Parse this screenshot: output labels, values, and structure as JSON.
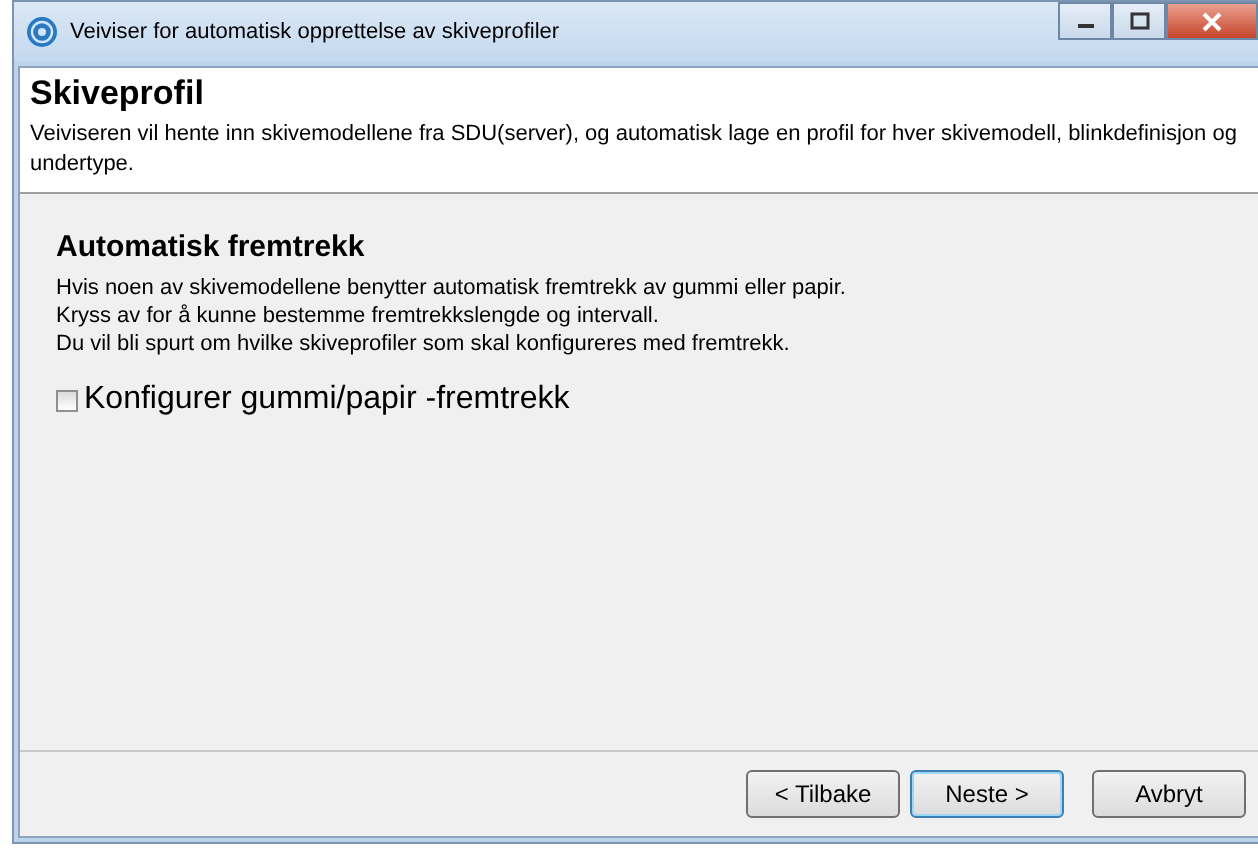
{
  "window": {
    "title": "Veiviser for automatisk opprettelse av skiveprofiler"
  },
  "header": {
    "title": "Skiveprofil",
    "description": "Veiviseren vil hente inn skivemodellene fra SDU(server), og automatisk lage en profil for hver skivemodell, blinkdefinisjon og undertype."
  },
  "section": {
    "title": "Automatisk fremtrekk",
    "lines": [
      "Hvis noen av skivemodellene benytter automatisk fremtrekk av gummi eller papir.",
      "Kryss av for å kunne bestemme fremtrekkslengde og intervall.",
      "Du vil bli spurt om hvilke skiveprofiler som skal konfigureres med fremtrekk."
    ]
  },
  "checkbox": {
    "label": "Konfigurer gummi/papir -fremtrekk",
    "checked": false
  },
  "buttons": [
    {
      "label": "< Tilbake",
      "kind": "normal"
    },
    {
      "label": "Neste >",
      "kind": "default"
    },
    {
      "label": "Avbryt",
      "kind": "cancel"
    }
  ]
}
